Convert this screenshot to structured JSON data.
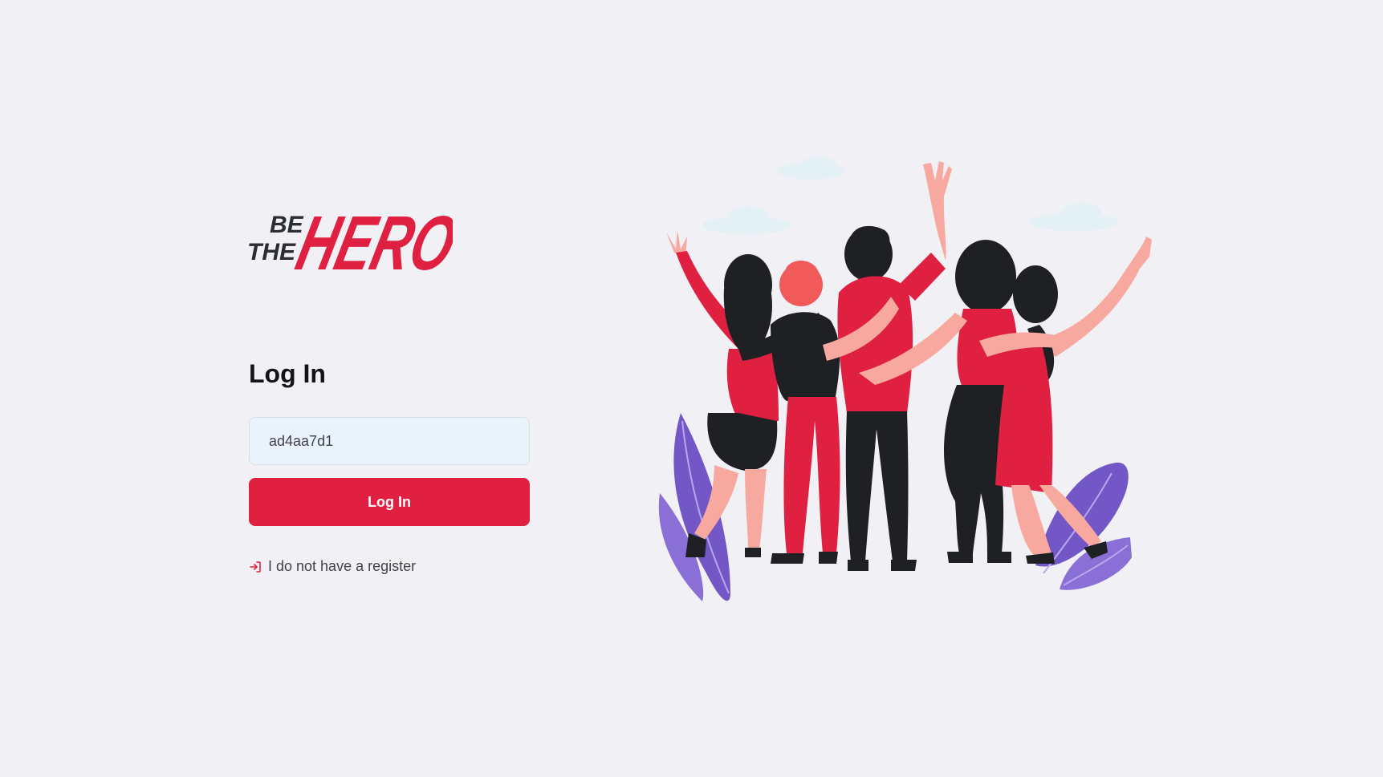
{
  "logo": {
    "line_1": "BE",
    "line_2": "THE",
    "word": "HERO",
    "colors": {
      "dark": "#2b2d36",
      "red": "#e02041"
    }
  },
  "login": {
    "title": "Log In",
    "id_input_value": "ad4aa7d1",
    "button_label": "Log In",
    "register_link_label": "I do not have a register",
    "register_icon": "log-in-icon"
  },
  "illustration": {
    "description_icon": "heroes-group-illustration"
  },
  "colors": {
    "background": "#f0f0f5",
    "accent": "#e02041",
    "text": "#41414d",
    "title": "#13131a",
    "input_bg": "#e8f4fa"
  }
}
